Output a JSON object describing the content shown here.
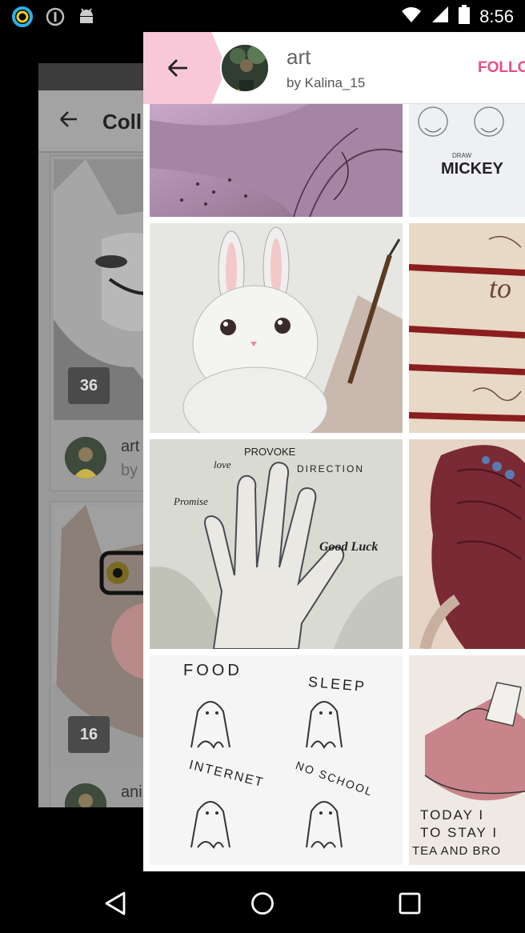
{
  "status_bar": {
    "time": "8:56",
    "icons": [
      "circle-app-icon",
      "info-icon",
      "android-icon",
      "wifi-icon",
      "signal-icon",
      "battery-icon"
    ]
  },
  "background_screen": {
    "title": "Coll",
    "cards": [
      {
        "count": "36",
        "name": "art",
        "by": "by"
      },
      {
        "count": "16",
        "name": "ani",
        "by": ""
      }
    ]
  },
  "collection": {
    "title": "art",
    "author": "by Kalina_15",
    "follow_label": "FOLLO",
    "accent_color": "#e84d86",
    "back_color": "#f8c8d8"
  },
  "tiles": [
    {
      "name": "lily-sketch",
      "text": ""
    },
    {
      "name": "mickey-sketch",
      "text": "MICKEY",
      "small": "DRAW"
    },
    {
      "name": "bunny-drawing",
      "text": ""
    },
    {
      "name": "pencils-drawing",
      "text": "to"
    },
    {
      "name": "hand-drawing",
      "words": [
        "PROVOKE",
        "love",
        "DIRECTION",
        "Promise",
        "Good Luck"
      ]
    },
    {
      "name": "girl-hair-drawing",
      "text": ""
    },
    {
      "name": "ghosts-drawing",
      "words": [
        "FOOD",
        "SLEEP",
        "INTERNET",
        "NO SCHOOL"
      ]
    },
    {
      "name": "bed-drawing",
      "words": [
        "TODAY I",
        "TO STAY I",
        "TEA AND BRO"
      ]
    }
  ],
  "nav": {
    "buttons": [
      "back",
      "home",
      "recents"
    ]
  }
}
